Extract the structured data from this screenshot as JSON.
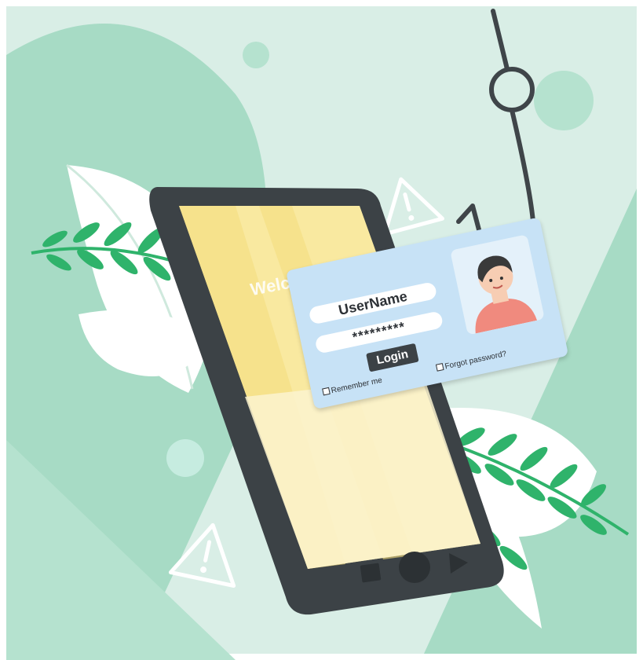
{
  "welcome_text": "Welcome!",
  "login_card": {
    "username_text": "UserName",
    "password_text": "*********",
    "login_label": "Login",
    "remember_label": "Remember me",
    "forgot_label": "Forgot password?"
  },
  "colors": {
    "background": "#d9eee6",
    "accent_green": "#a7dbc5",
    "phone_body": "#3c4246",
    "screen_yellow": "#f9e9a0",
    "card_blue": "#c7e2f6",
    "leaf_green": "#2fb36b",
    "hook": "#3f4549"
  },
  "icons": [
    "fishing-hook-icon",
    "warning-triangle-icon",
    "warning-triangle-icon"
  ]
}
